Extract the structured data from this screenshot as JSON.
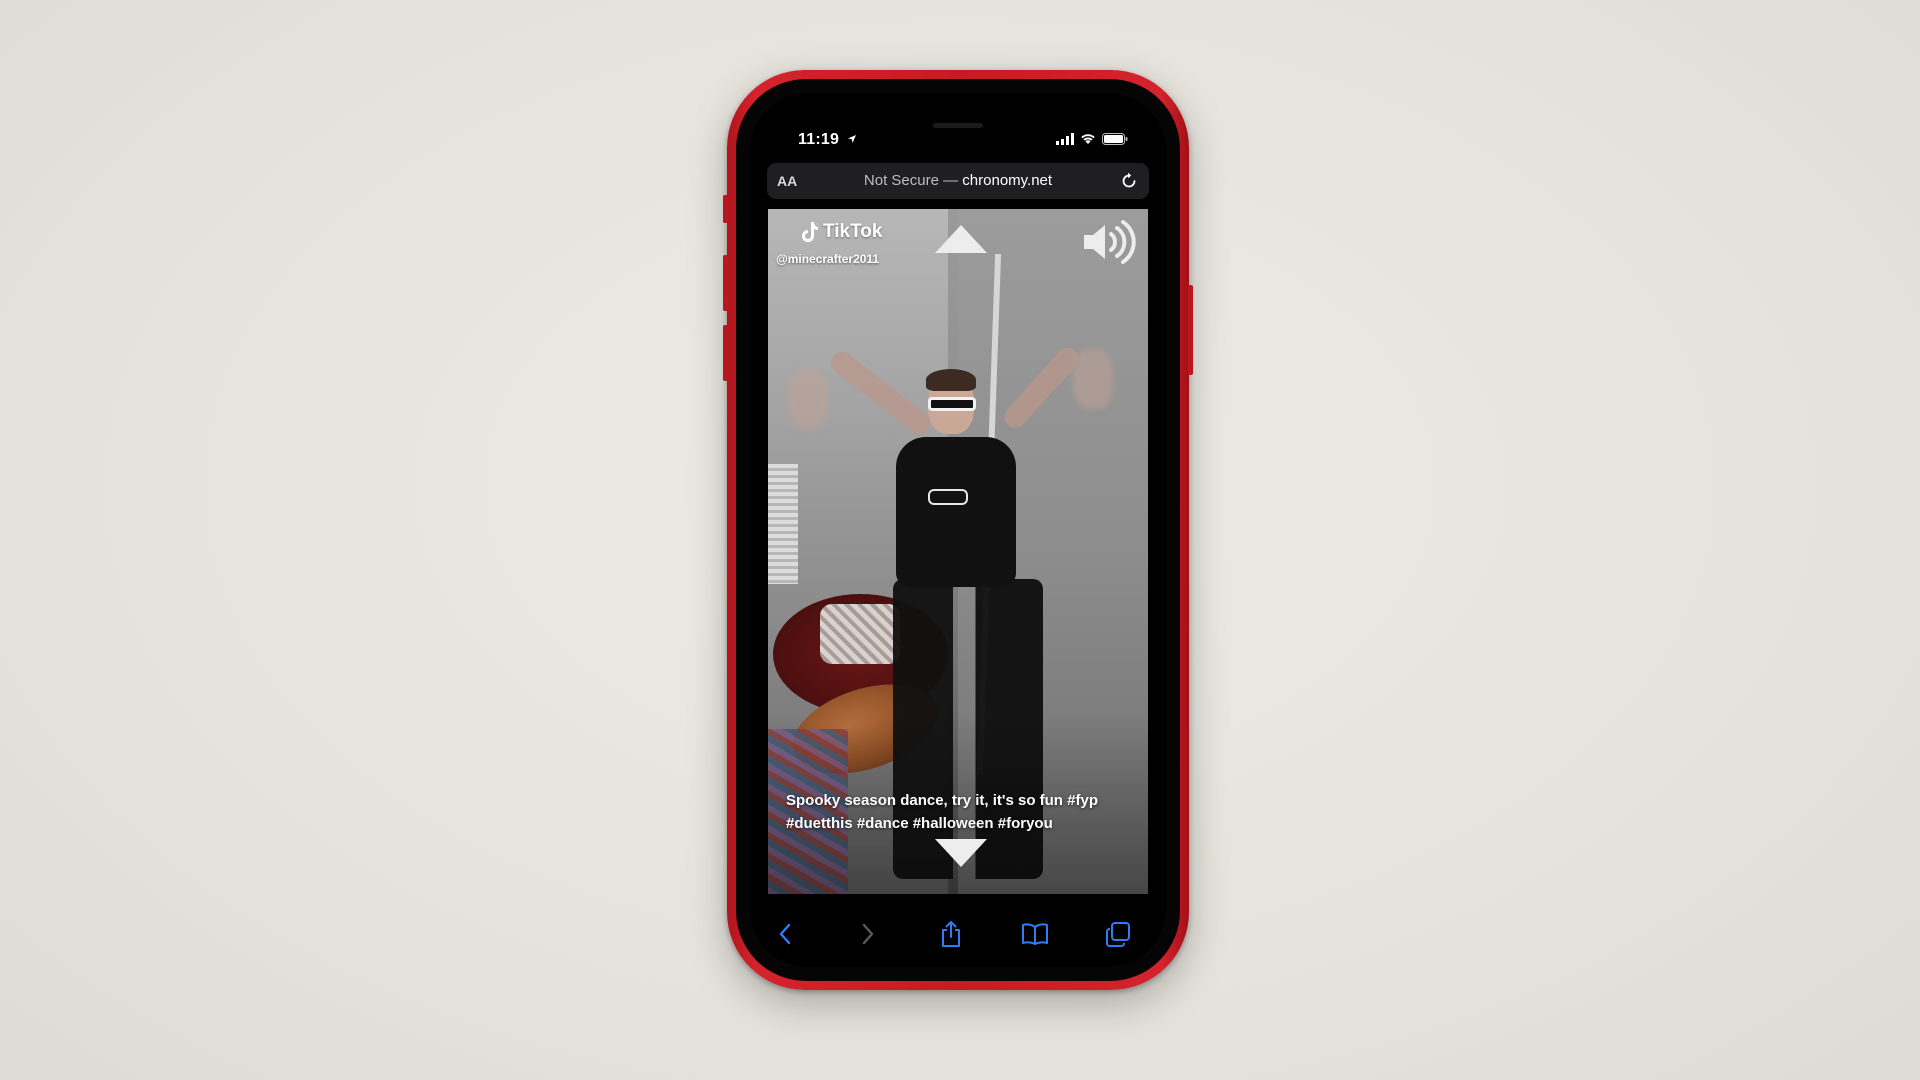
{
  "status": {
    "time": "11:19",
    "location_icon": "location-arrow-icon",
    "signal_icon": "cellular-signal-icon",
    "wifi_icon": "wifi-icon",
    "battery_icon": "battery-icon"
  },
  "address_bar": {
    "text_size_label": "AA",
    "security_label": "Not Secure — ",
    "domain": "chronomy.net",
    "reload_icon": "reload-icon"
  },
  "video": {
    "brand": "TikTok",
    "username": "@minecrafter2011",
    "caption_line1": "Spooky season dance, try it, it's so fun #fyp",
    "caption_line2": "#duetthis #dance #halloween #foryou",
    "prev_icon": "triangle-up-icon",
    "next_icon": "triangle-down-icon",
    "sound_icon": "speaker-volume-icon"
  },
  "toolbar": {
    "back_icon": "chevron-left-icon",
    "forward_icon": "chevron-right-icon",
    "share_icon": "share-icon",
    "bookmarks_icon": "book-icon",
    "tabs_icon": "tabs-icon"
  },
  "colors": {
    "phone_red": "#c61b24",
    "safari_blue": "#2f7cf6",
    "background": "#e9e6e1"
  }
}
